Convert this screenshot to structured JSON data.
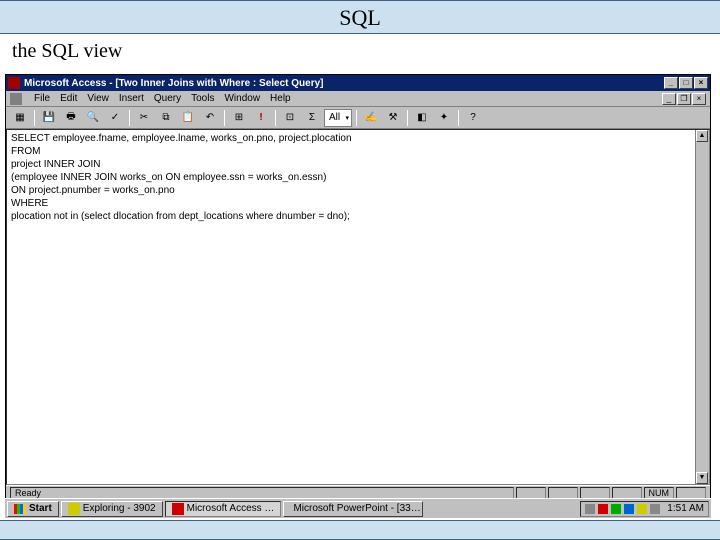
{
  "slide": {
    "title": "SQL",
    "subtitle": "the SQL view"
  },
  "window": {
    "title": "Microsoft Access - [Two Inner Joins with Where : Select Query]"
  },
  "menubar": {
    "file": "File",
    "edit": "Edit",
    "view": "View",
    "insert": "Insert",
    "query": "Query",
    "tools": "Tools",
    "window": "Window",
    "help": "Help"
  },
  "toolbar": {
    "dropdown_all": "All"
  },
  "sql": {
    "l1": "SELECT employee.fname, employee.lname, works_on.pno, project.plocation",
    "l2": "",
    "l3": "FROM",
    "l4": "project INNER JOIN",
    "l5": "(employee INNER JOIN works_on ON employee.ssn = works_on.essn)",
    "l6": "ON project.pnumber = works_on.pno",
    "l7": "",
    "l8": "WHERE",
    "l9": "plocation not in (select dlocation from dept_locations where dnumber = dno);"
  },
  "statusbar": {
    "left": "Ready",
    "num": "NUM"
  },
  "taskbar": {
    "start": "Start",
    "task1": "Exploring - 3902",
    "task2": "Microsoft Access …",
    "task3": "Microsoft PowerPoint - [33…",
    "clock": "1:51 AM"
  }
}
